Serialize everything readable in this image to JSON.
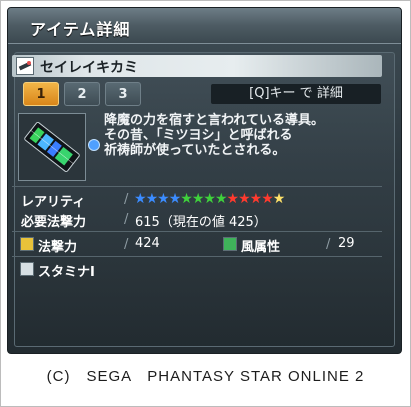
{
  "window": {
    "title": "アイテム詳細"
  },
  "item": {
    "name": "セイレイキカミ",
    "name_icon": "wand-icon",
    "tabs": [
      {
        "label": "1",
        "active": true
      },
      {
        "label": "2",
        "active": false
      },
      {
        "label": "3",
        "active": false
      }
    ],
    "detail_hint": "[Q]キー で 詳細",
    "description": [
      "降魔の力を宿すと言われている導具。",
      "その昔、「ミツヨシ」と呼ばれる",
      "祈祷師が使っていたとされる。"
    ],
    "rarity_label": "レアリティ",
    "rarity_stars": 13,
    "star_colors": [
      "#3b8cff",
      "#3b8cff",
      "#3b8cff",
      "#3b8cff",
      "#3fd13c",
      "#3fd13c",
      "#3fd13c",
      "#3fd13c",
      "#ff3a2e",
      "#ff3a2e",
      "#ff3a2e",
      "#ff3a2e",
      "#ffe26a"
    ],
    "requirement_label": "必要法撃力",
    "requirement_value": "615（現在の値 425）",
    "stats": [
      {
        "icon": "key-icon",
        "label": "法撃力",
        "value": "424"
      },
      {
        "icon": "wind-element-icon",
        "label": "風属性",
        "value": "29"
      }
    ],
    "ability": {
      "icon": "ability-icon",
      "label": "スタミナⅠ"
    }
  },
  "footer": {
    "copyright": "(C)　SEGA　PHANTASY STAR ONLINE 2"
  },
  "colors": {
    "tab_active": "#e39c2f",
    "panel_bg": "#2d383f",
    "title_bar": "#56646b"
  }
}
